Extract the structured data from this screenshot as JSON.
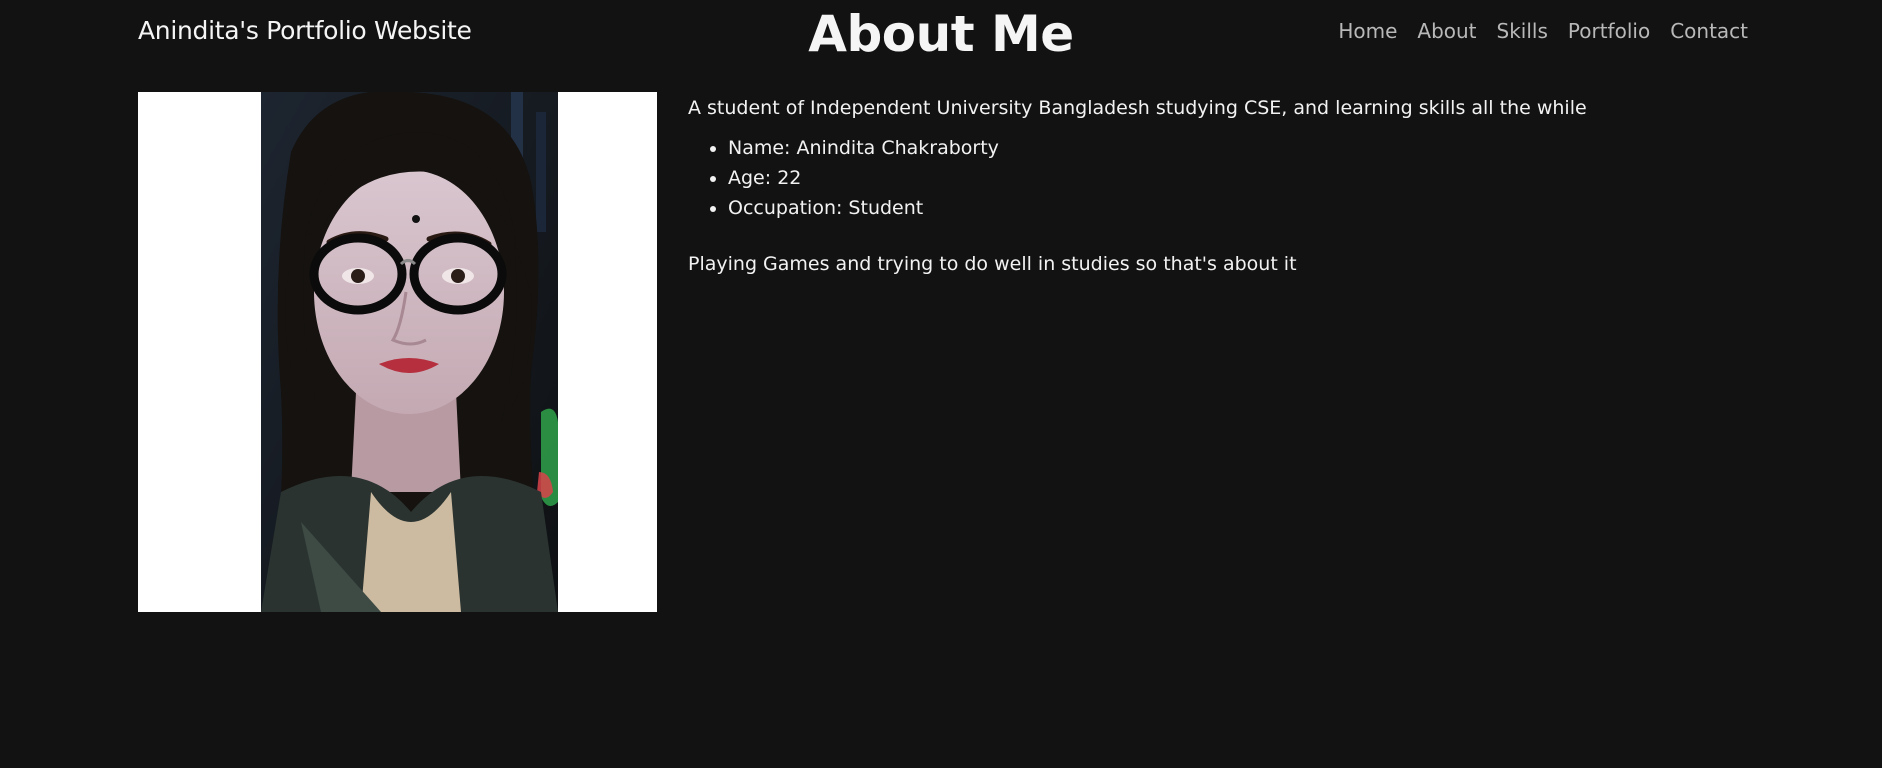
{
  "header": {
    "brand": "Anindita's Portfolio Website",
    "title": "About Me",
    "nav": [
      {
        "label": "Home"
      },
      {
        "label": "About"
      },
      {
        "label": "Skills"
      },
      {
        "label": "Portfolio"
      },
      {
        "label": "Contact"
      }
    ]
  },
  "about": {
    "intro": "A student of Independent University Bangladesh studying CSE, and learning skills all the while",
    "facts": [
      {
        "text": "Name: Anindita Chakraborty"
      },
      {
        "text": "Age: 22"
      },
      {
        "text": "Occupation: Student"
      }
    ],
    "hobbies": "Playing Games and trying to do well in studies so that's about it"
  },
  "colors": {
    "background": "#121212",
    "text": "#f2f2f2",
    "nav_text": "#b8b8b8",
    "photo_frame": "#ffffff"
  }
}
